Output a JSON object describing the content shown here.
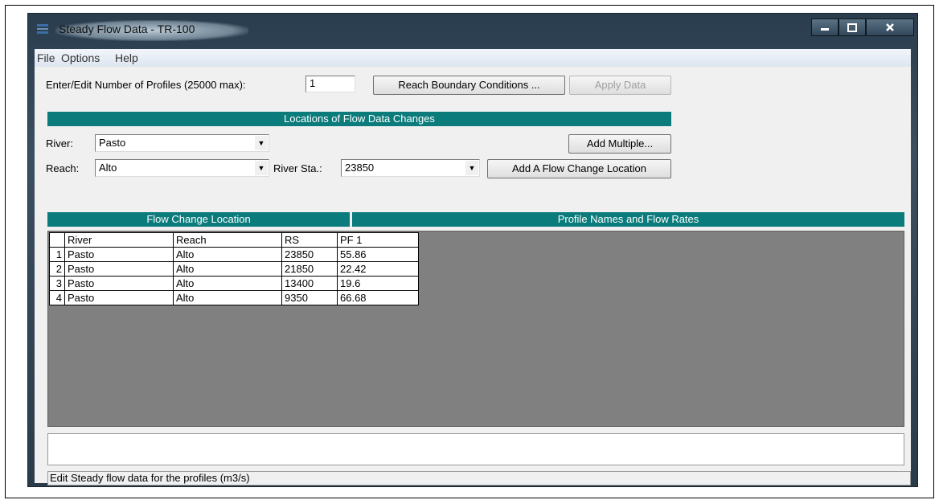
{
  "window": {
    "title": "Steady Flow Data - TR-100"
  },
  "menu": {
    "file": "File",
    "options": "Options",
    "help": "Help"
  },
  "profiles": {
    "label": "Enter/Edit Number of Profiles (25000 max):",
    "value": "1",
    "reach_boundary_button": "Reach Boundary Conditions ...",
    "apply_button": "Apply Data"
  },
  "locations": {
    "header": "Locations of Flow Data Changes",
    "river_label": "River:",
    "river_value": "Pasto",
    "reach_label": "Reach:",
    "reach_value": "Alto",
    "station_label": "River Sta.:",
    "station_value": "23850",
    "add_multiple_button": "Add Multiple...",
    "add_location_button": "Add A Flow Change Location"
  },
  "grid": {
    "left_header": "Flow Change Location",
    "right_header": "Profile Names and Flow Rates",
    "columns": [
      "",
      "River",
      "Reach",
      "RS",
      "PF 1"
    ],
    "rows": [
      [
        "1",
        "Pasto",
        "Alto",
        "23850",
        "55.86"
      ],
      [
        "2",
        "Pasto",
        "Alto",
        "21850",
        "22.42"
      ],
      [
        "3",
        "Pasto",
        "Alto",
        "13400",
        "19.6"
      ],
      [
        "4",
        "Pasto",
        "Alto",
        "9350",
        "66.68"
      ]
    ]
  },
  "status": {
    "text": "Edit Steady flow data for the profiles (m3/s)"
  },
  "colors": {
    "teal_header": "#0b7b7b",
    "grid_bg": "#808080"
  }
}
